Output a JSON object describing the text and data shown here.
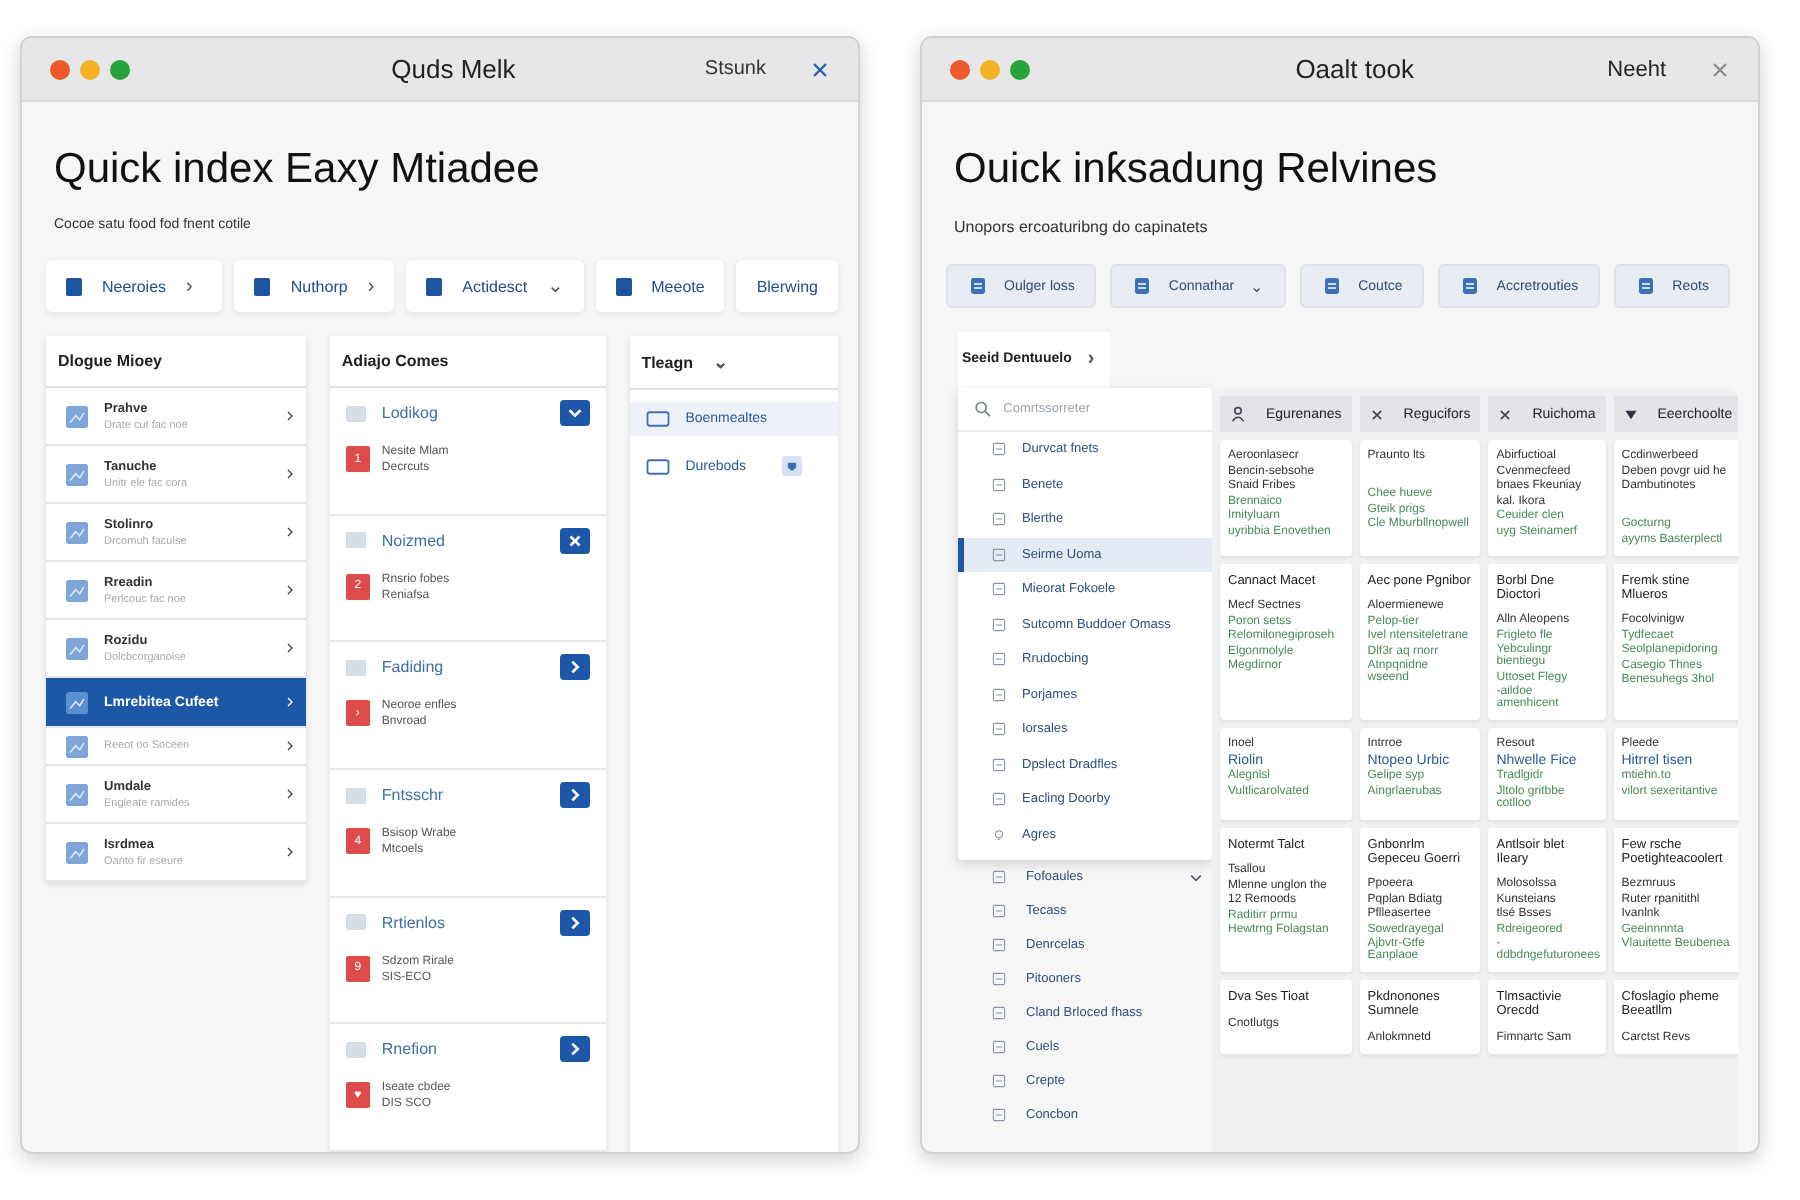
{
  "left_window": {
    "title": "Quds Melk",
    "action": "Stsunk",
    "heading": "Quick index Eaxy Mtiadee",
    "subtitle": "Cocoe satu food fod fnent cotile",
    "toolbar": [
      {
        "label": "Neeroies",
        "icon": true,
        "caret": "›"
      },
      {
        "label": "Nuthorp",
        "icon": true,
        "caret": "›"
      },
      {
        "label": "Actidesct",
        "icon": true,
        "caret": "⌄"
      },
      {
        "label": "Meeote",
        "icon": true
      },
      {
        "label": "Blerwing",
        "icon": false
      }
    ],
    "list_panel": {
      "title": "Dlogue Mioey",
      "items": [
        {
          "title": "Prahve",
          "subtitle": "Drate cut fac noe",
          "selected": false
        },
        {
          "title": "Tanuche",
          "subtitle": "Unitr ele fac cora",
          "selected": false
        },
        {
          "title": "Stolinro",
          "subtitle": "Drcomuh faculse",
          "selected": false
        },
        {
          "title": "Rreadin",
          "subtitle": "Perlcouc fac noe",
          "selected": false
        },
        {
          "title": "Rozidu",
          "subtitle": "Dolcbcorganoise",
          "selected": false
        },
        {
          "title": "Lmrebitea Cufeet",
          "selected": true
        },
        {
          "subtitle": "Reeot oo Soceen",
          "selected": false
        },
        {
          "title": "Umdale",
          "subtitle": "Engleate ramides",
          "selected": false
        },
        {
          "title": "Isrdmea",
          "subtitle": "Oanto fir eseure",
          "selected": false
        }
      ]
    },
    "cards_panel": {
      "title": "Adiajo Comes",
      "cards": [
        {
          "title": "Lodikog",
          "kind": "down",
          "badge": "1",
          "lines": [
            "Nesite Mlam",
            "Decrcuts"
          ]
        },
        {
          "title": "Noizmed",
          "kind": "close",
          "badge": "2",
          "lines": [
            "Rnsrio fobes",
            "Reniafsa"
          ]
        },
        {
          "title": "Fadiding",
          "kind": "next",
          "badge": "›",
          "lines": [
            "Neoroe enfles",
            "Bnvroad"
          ]
        },
        {
          "title": "Fntsschr",
          "kind": "next",
          "badge": "4",
          "lines": [
            "Bsisop Wrabe",
            "Mtcoels"
          ]
        },
        {
          "title": "Rrtienlos",
          "kind": "next",
          "badge": "9",
          "lines": [
            "Sdzom Rirale",
            "SIS-ECO"
          ]
        },
        {
          "title": "Rnefion",
          "kind": "next",
          "badge": "♥",
          "lines": [
            "Iseate cbdee",
            "DIS SCO"
          ]
        }
      ]
    },
    "tag_panel": {
      "title": "Tleagn",
      "caret": "⌄",
      "items": [
        {
          "label": "Boenmealtes",
          "selected": true,
          "badge": false
        },
        {
          "label": "Durebods",
          "selected": false,
          "badge": true
        }
      ]
    }
  },
  "right_window": {
    "title": "Oaalt took",
    "action": "Neeht",
    "heading": "Ouick inƙsadung Relvines",
    "subtitle": "Unopors ercoaturibng do capinatets",
    "toolbar": [
      {
        "label": "Oulger loss"
      },
      {
        "label": "Connathar",
        "caret": "⌄"
      },
      {
        "label": "Coutce"
      },
      {
        "label": "Accretrouties"
      },
      {
        "label": "Reots"
      }
    ],
    "tab": {
      "label": "Seeid Dentuuelo",
      "caret": "›"
    },
    "dropdown": {
      "placeholder": "Comrtssorreter",
      "items": [
        {
          "label": "Durvcat fnets",
          "kind": "file",
          "selected": false
        },
        {
          "label": "Benete",
          "kind": "file",
          "selected": false
        },
        {
          "label": "Blerthe",
          "kind": "file",
          "selected": false
        },
        {
          "label": "Seirme Uoma",
          "kind": "file",
          "selected": true
        },
        {
          "label": "Mieorat Fokoele",
          "kind": "file",
          "selected": false
        },
        {
          "label": "Sutcomn Buddoer Omass",
          "kind": "file",
          "selected": false
        },
        {
          "label": "Rrudocbing",
          "kind": "file",
          "selected": false
        },
        {
          "label": "Porjames",
          "kind": "file",
          "selected": false
        },
        {
          "label": "Iorsales",
          "kind": "file",
          "selected": false
        },
        {
          "label": "Dpslect Dradfles",
          "kind": "file",
          "selected": false
        },
        {
          "label": "Eacling Doorby",
          "kind": "file",
          "selected": false
        },
        {
          "label": "Agres",
          "kind": "bulb",
          "selected": false
        }
      ]
    },
    "list": [
      {
        "label": "Fofoaules",
        "expandable": true
      },
      {
        "label": "Tecass",
        "expandable": false
      },
      {
        "label": "Denrcelas",
        "expandable": false
      },
      {
        "label": "Pitooners",
        "expandable": false
      },
      {
        "label": "Cland Brloced fhass",
        "expandable": false
      },
      {
        "label": "Cuels",
        "expandable": false
      },
      {
        "label": "Crepte",
        "expandable": false
      },
      {
        "label": "Concbon",
        "expandable": false
      }
    ],
    "board": {
      "columns": [
        {
          "label": "Egurenanes",
          "kind": "person"
        },
        {
          "label": "Regucifors",
          "kind": "close"
        },
        {
          "label": "Ruichoma",
          "kind": "close"
        },
        {
          "label": "Eeerchoolte",
          "kind": "filter"
        }
      ],
      "rows": [
        [
          {
            "lines": [
              {
                "kind": "text",
                "text": "Aeroonlasecr"
              },
              {
                "kind": "text",
                "text": "Bencin-sebsohe"
              },
              {
                "kind": "text",
                "text": "Snaid Fribes"
              },
              {
                "kind": "green",
                "text": "Brennaico"
              },
              {
                "kind": "green",
                "text": "Imityluarn"
              },
              {
                "kind": "green",
                "text": "uyribbia Enovethen"
              }
            ]
          },
          {
            "lines": [
              {
                "kind": "text",
                "text": "Praunto lts"
              },
              {
                "kind": "gap"
              },
              {
                "kind": "green",
                "text": "Chee hueve"
              },
              {
                "kind": "green",
                "text": "Gteik prigs"
              },
              {
                "kind": "green",
                "text": "Cle Mburbllnopwell"
              }
            ]
          },
          {
            "lines": [
              {
                "kind": "text",
                "text": "Abirfuctioal"
              },
              {
                "kind": "text",
                "text": "Cvenmecfeed"
              },
              {
                "kind": "text",
                "text": "bnaes Fkeuniay"
              },
              {
                "kind": "text",
                "text": "kal. Ikora"
              },
              {
                "kind": "green",
                "text": "Ceuider clen"
              },
              {
                "kind": "green",
                "text": "uyg Steinamerf"
              }
            ]
          },
          {
            "lines": [
              {
                "kind": "text",
                "text": "Ccdinwerbeed"
              },
              {
                "kind": "text",
                "text": "Deben povgr uid he"
              },
              {
                "kind": "text",
                "text": "Dambutinotes"
              },
              {
                "kind": "gap"
              },
              {
                "kind": "green",
                "text": "Gocturng"
              },
              {
                "kind": "green",
                "text": "ayyms Basterplectl"
              }
            ]
          }
        ],
        [
          {
            "lines": [
              {
                "kind": "title",
                "text": "Cannact Macet"
              },
              {
                "kind": "text",
                "text": "Mecf Sectnes"
              },
              {
                "kind": "green",
                "text": "Poron setss"
              },
              {
                "kind": "green",
                "text": "Relomilonegiproseh"
              },
              {
                "kind": "green",
                "text": "Elgonmolyle"
              },
              {
                "kind": "green",
                "text": "Megdirnor"
              }
            ]
          },
          {
            "lines": [
              {
                "kind": "title",
                "text": "Aec pone Pgnibor"
              },
              {
                "kind": "text",
                "text": "Aloermienewe"
              },
              {
                "kind": "green",
                "text": "Pelop-tier"
              },
              {
                "kind": "green",
                "text": "Ivel ntensiteletrane"
              },
              {
                "kind": "green",
                "text": "Dlf3r aq rnorr"
              },
              {
                "kind": "green",
                "text": "Atnpqnidne wseend"
              }
            ]
          },
          {
            "lines": [
              {
                "kind": "title",
                "text": "Borbl Dne Dioctori"
              },
              {
                "kind": "text",
                "text": "Alln Aleopens"
              },
              {
                "kind": "green",
                "text": "Frigleto fle"
              },
              {
                "kind": "green",
                "text": "Yebculingr bientiegu"
              },
              {
                "kind": "green",
                "text": "Uttoset Flegy"
              },
              {
                "kind": "green",
                "text": "-aildoe amenhicent"
              }
            ]
          },
          {
            "lines": [
              {
                "kind": "title",
                "text": "Fremk stine Mlueros"
              },
              {
                "kind": "text",
                "text": "Focolvinigw"
              },
              {
                "kind": "green",
                "text": "Tydfecaet"
              },
              {
                "kind": "green",
                "text": "Seolplanepidoring"
              },
              {
                "kind": "green",
                "text": "Casegio Thnes"
              },
              {
                "kind": "green",
                "text": "Benesuhegs 3hol"
              }
            ]
          }
        ],
        [
          {
            "lines": [
              {
                "kind": "text",
                "text": "Inoel"
              },
              {
                "kind": "link",
                "text": "Riolin"
              },
              {
                "kind": "green",
                "text": "Alegnlsl"
              },
              {
                "kind": "green",
                "text": "Vultlicarolvated"
              }
            ]
          },
          {
            "lines": [
              {
                "kind": "text",
                "text": "Intrroe"
              },
              {
                "kind": "link",
                "text": "Ntopeo Urbic"
              },
              {
                "kind": "green",
                "text": "Gelipe syp"
              },
              {
                "kind": "green",
                "text": "Aingrlaerubas"
              }
            ]
          },
          {
            "lines": [
              {
                "kind": "text",
                "text": "Resout"
              },
              {
                "kind": "link",
                "text": "Nhwelle Fice"
              },
              {
                "kind": "green",
                "text": "Tradlgidr"
              },
              {
                "kind": "green",
                "text": "Jltolo gritbbe cotlloo"
              }
            ]
          },
          {
            "lines": [
              {
                "kind": "text",
                "text": "Pleede"
              },
              {
                "kind": "link",
                "text": "Hitrrel tisen"
              },
              {
                "kind": "green",
                "text": "mtiehn.to"
              },
              {
                "kind": "green",
                "text": "vilort sexeritantive"
              }
            ]
          }
        ],
        [
          {
            "lines": [
              {
                "kind": "title",
                "text": "Notermt Talct"
              },
              {
                "kind": "text",
                "text": "Tsallou"
              },
              {
                "kind": "text",
                "text": "Mlenne unglon the"
              },
              {
                "kind": "text",
                "text": "12 Remoods"
              },
              {
                "kind": "green",
                "text": "Raditirr prmu"
              },
              {
                "kind": "green",
                "text": "Hewtrng Folagstan"
              }
            ]
          },
          {
            "lines": [
              {
                "kind": "title",
                "text": "Gnbonrlm Gepeceu Goerri"
              },
              {
                "kind": "text",
                "text": "Ppoeera"
              },
              {
                "kind": "text",
                "text": "Pqplan Bdiatg"
              },
              {
                "kind": "text",
                "text": "Pflleasertee"
              },
              {
                "kind": "green",
                "text": "Sowedrayegal"
              },
              {
                "kind": "green",
                "text": "Ajbvtr-Gtfe Eanplaoe"
              }
            ]
          },
          {
            "lines": [
              {
                "kind": "title",
                "text": "Antlsoir blet Ileary"
              },
              {
                "kind": "text",
                "text": "Molosolssa"
              },
              {
                "kind": "text",
                "text": "Kunsteians"
              },
              {
                "kind": "text",
                "text": "tlsé Bsses"
              },
              {
                "kind": "green",
                "text": "Rdreigeored"
              },
              {
                "kind": "green",
                "text": "-ddbdngefuturonees"
              }
            ]
          },
          {
            "lines": [
              {
                "kind": "title",
                "text": "Few rsche Poetighteacoolert"
              },
              {
                "kind": "text",
                "text": "Bezmruus"
              },
              {
                "kind": "text",
                "text": "Ruter rpanitithl"
              },
              {
                "kind": "text",
                "text": "Ivanlnk"
              },
              {
                "kind": "green",
                "text": "Geeinnnnta"
              },
              {
                "kind": "green",
                "text": "Vlauitette Beubenea"
              }
            ]
          }
        ],
        [
          {
            "lines": [
              {
                "kind": "title",
                "text": "Dva Ses Tioat"
              },
              {
                "kind": "text",
                "text": "Cnotlutgs"
              }
            ]
          },
          {
            "lines": [
              {
                "kind": "title",
                "text": "Pkdnonones Sumnele"
              },
              {
                "kind": "text",
                "text": "Anlokmnetd"
              }
            ]
          },
          {
            "lines": [
              {
                "kind": "title",
                "text": "Tlmsactivie Orecdd"
              },
              {
                "kind": "text",
                "text": "Fimnartc Sam"
              }
            ]
          },
          {
            "lines": [
              {
                "kind": "title",
                "text": "Cfoslagio pheme Beeatllm"
              },
              {
                "kind": "text",
                "text": "Carctst Revs"
              }
            ]
          }
        ]
      ]
    }
  }
}
